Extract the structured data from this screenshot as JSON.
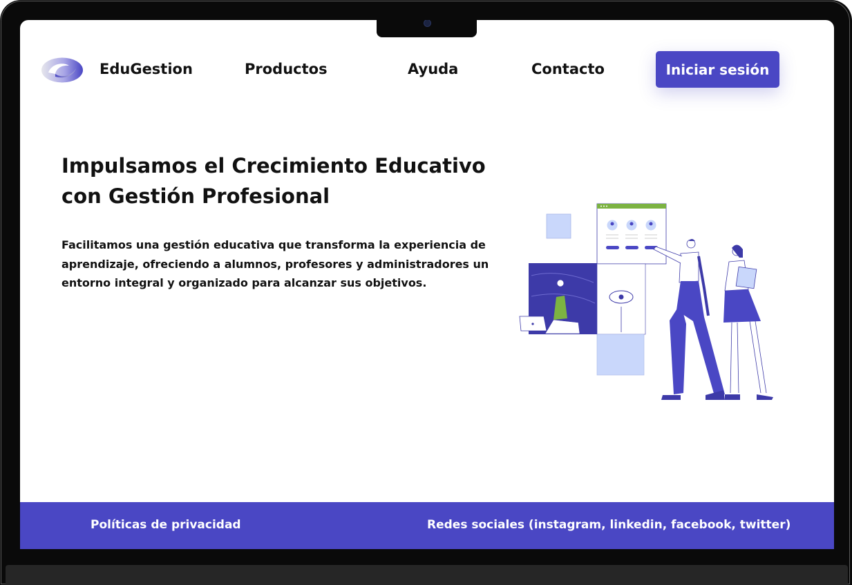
{
  "brand": {
    "name": "EduGestion",
    "logo_icon": "swirl-logo-icon"
  },
  "nav": {
    "items": [
      {
        "label": "Productos"
      },
      {
        "label": "Ayuda"
      },
      {
        "label": "Contacto"
      }
    ],
    "login_label": "Iniciar sesión"
  },
  "hero": {
    "title": "Impulsamos el Crecimiento Educativo con Gestión Profesional",
    "description": "Facilitamos una gestión educativa que transforma la experiencia de aprendizaje, ofreciendo a alumnos, profesores y administradores un entorno integral y organizado para alcanzar sus objetivos."
  },
  "footer": {
    "privacy_label": "Políticas de privacidad",
    "social_label": "Redes sociales (instagram, linkedin, facebook, twitter)"
  },
  "colors": {
    "accent": "#4a47c4",
    "illustration_light": "#c9d7fb",
    "illustration_green": "#7cb342"
  }
}
